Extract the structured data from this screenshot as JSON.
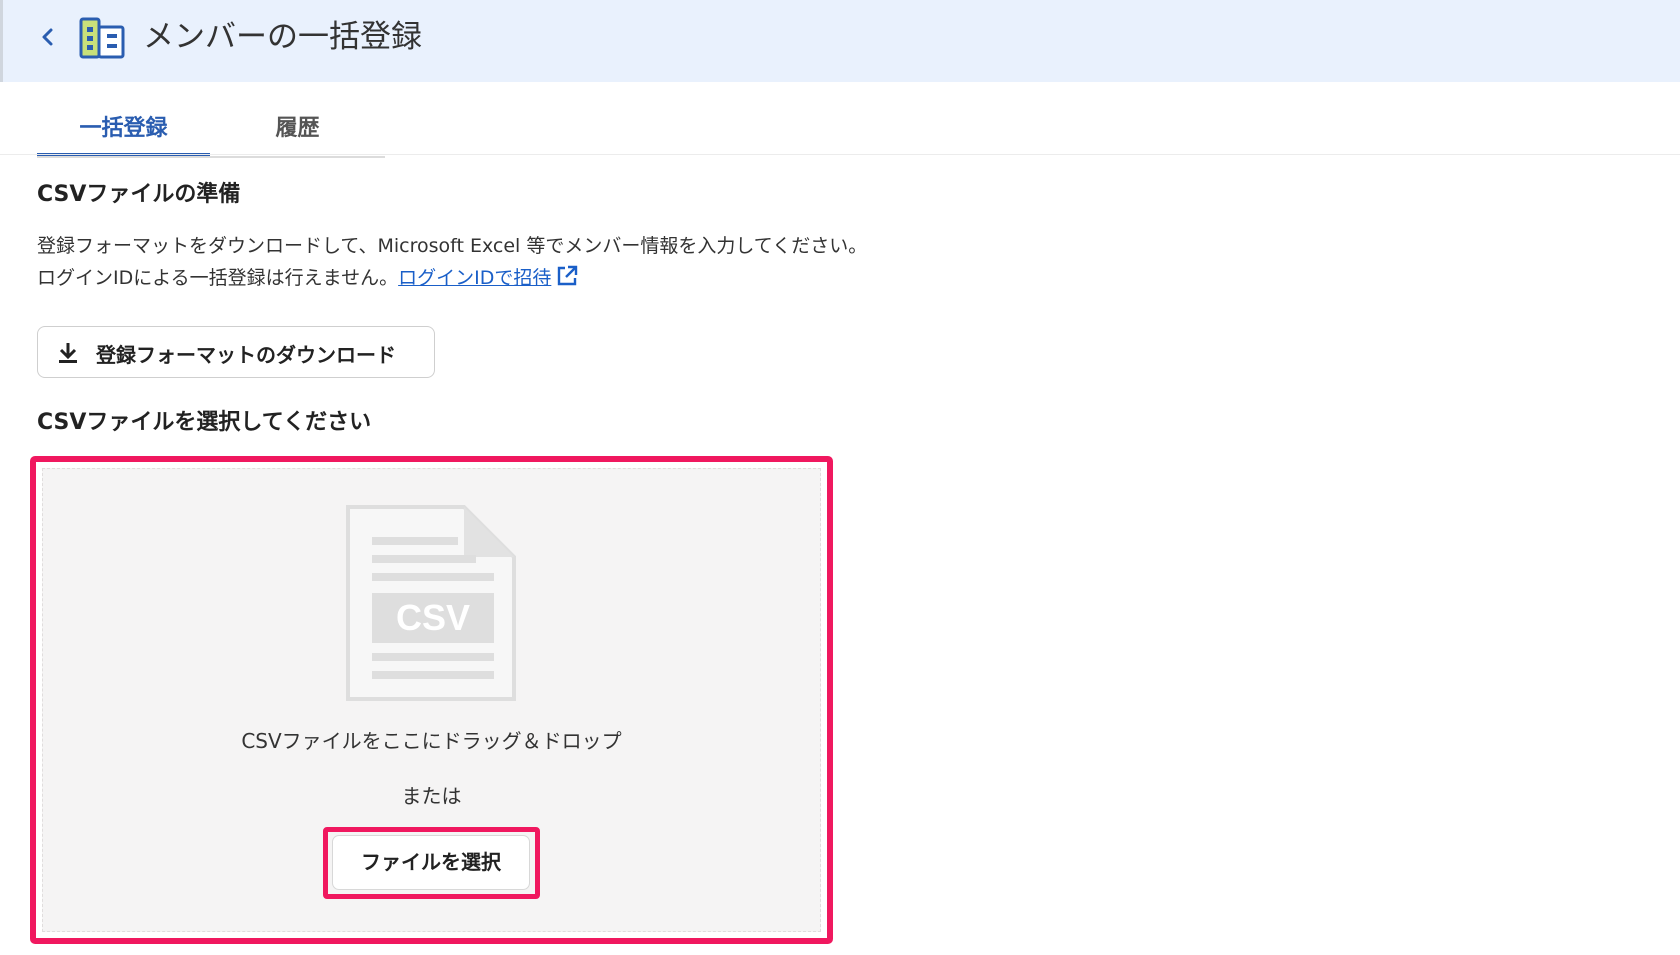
{
  "header": {
    "back_icon": "chevron-left-icon",
    "app_icon": "member-directory-icon",
    "title": "メンバーの一括登録"
  },
  "tabs": [
    {
      "label": "一括登録",
      "active": true
    },
    {
      "label": "履歴",
      "active": false
    }
  ],
  "prepare": {
    "title": "CSVファイルの準備",
    "line1": "登録フォーマットをダウンロードして、Microsoft Excel 等でメンバー情報を入力してください。",
    "line2_prefix": "ログインIDによる一括登録は行えません。",
    "line2_link": "ログインIDで招待",
    "link_icon": "external-link-icon",
    "download_button": "登録フォーマットのダウンロード",
    "download_icon": "download-icon"
  },
  "select": {
    "title": "CSVファイルを選択してください",
    "file_icon": "csv-file-icon",
    "file_icon_label": "CSV",
    "drop_text": "CSVファイルをここにドラッグ＆ドロップ",
    "or_text": "または",
    "choose_button": "ファイルを選択"
  },
  "colors": {
    "accent": "#2a5db0",
    "link": "#1a5fc8",
    "highlight": "#f0185f",
    "header_bg": "#e9f1fd",
    "dropzone_bg": "#f5f4f4"
  }
}
